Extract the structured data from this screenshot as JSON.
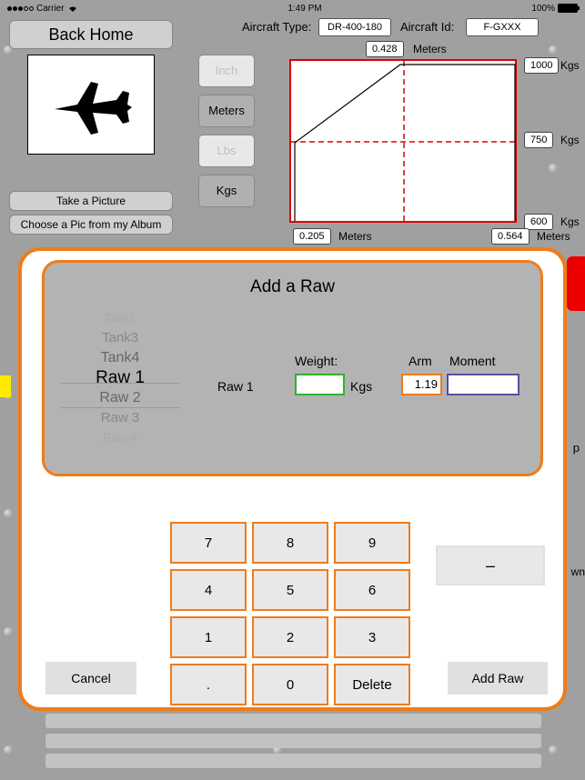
{
  "status": {
    "carrier": "Carrier",
    "time": "1:49 PM",
    "battery": "100%"
  },
  "nav": {
    "back_home": "Back Home",
    "take_picture": "Take a Picture",
    "choose_pic": "Choose a Pic from my Album"
  },
  "aircraft": {
    "type_label": "Aircraft Type:",
    "type_value": "DR-400-180",
    "id_label": "Aircraft Id:",
    "id_value": "F-GXXX"
  },
  "units": {
    "inch": "Inch",
    "meters": "Meters",
    "lbs": "Lbs",
    "kgs": "Kgs"
  },
  "chart_data": {
    "type": "area",
    "x_unit": "Meters",
    "y_unit": "Kgs",
    "x_top_marker": 0.428,
    "x_left_bottom": 0.205,
    "x_right_bottom": 0.564,
    "y_ticks": [
      1000,
      750,
      600
    ],
    "envelope": [
      {
        "x": 0.205,
        "y": 600
      },
      {
        "x": 0.205,
        "y": 750
      },
      {
        "x": 0.428,
        "y": 1000
      },
      {
        "x": 0.564,
        "y": 1000
      },
      {
        "x": 0.564,
        "y": 600
      }
    ]
  },
  "modal": {
    "title": "Add a Raw",
    "picker": [
      "Tank2",
      "Tank3",
      "Tank4",
      "Raw 1",
      "Raw 2",
      "Raw 3",
      "Raw 4"
    ],
    "selected": "Raw 1",
    "row_name": "Raw 1",
    "weight_label": "Weight:",
    "weight_unit": "Kgs",
    "weight_value": "",
    "arm_label": "Arm",
    "arm_value": "1.19",
    "moment_label": "Moment",
    "moment_value": "",
    "keys": [
      "7",
      "8",
      "9",
      "4",
      "5",
      "6",
      "1",
      "2",
      "3",
      ".",
      "0",
      "Delete"
    ],
    "minus": "–",
    "cancel": "Cancel",
    "add": "Add Raw"
  },
  "fragments": {
    "p": "p",
    "wn": "wn"
  }
}
